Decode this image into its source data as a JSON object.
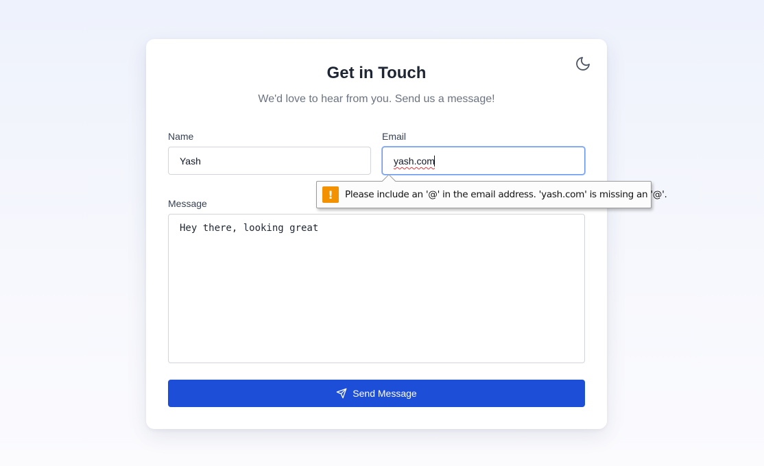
{
  "form": {
    "title": "Get in Touch",
    "subtitle": "We'd love to hear from you. Send us a message!",
    "name": {
      "label": "Name",
      "value": "Yash"
    },
    "email": {
      "label": "Email",
      "value": "yash.com"
    },
    "message": {
      "label": "Message",
      "value": "Hey there, looking great"
    },
    "submit_label": "Send Message"
  },
  "validation_tooltip": {
    "icon": "warning-icon",
    "text": "Please include an '@' in the email address. 'yash.com' is missing an '@'."
  },
  "theme_toggle": {
    "icon": "moon-icon"
  },
  "colors": {
    "accent": "#1d4ed8",
    "focus": "#3b82f6",
    "warning": "#f39200"
  }
}
